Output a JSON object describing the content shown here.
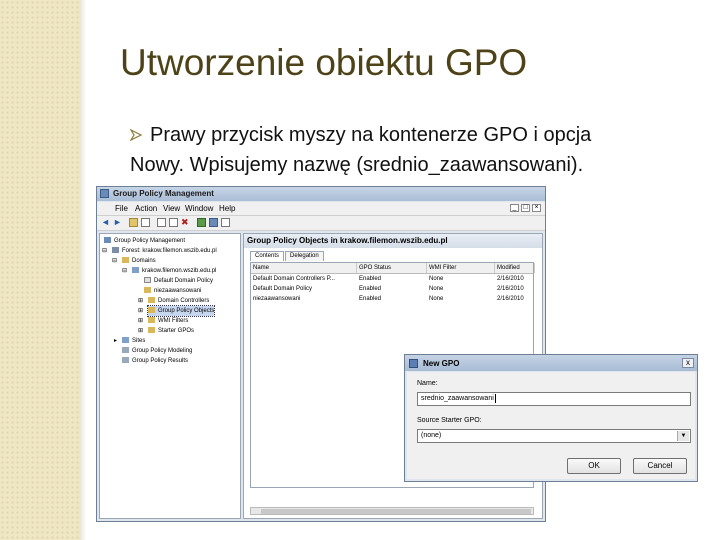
{
  "slide": {
    "title": "Utworzenie obiektu GPO",
    "bullet_line1": "Prawy przycisk myszy na kontenerze GPO i opcja",
    "bullet_line2": "Nowy. Wpisujemy nazwę (srednio_zaawansowani).",
    "colors": {
      "title": "#4e4218",
      "paper": "#efe6c4"
    }
  },
  "gpm": {
    "title": "Group Policy Management",
    "menu": [
      "File",
      "Action",
      "View",
      "Window",
      "Help"
    ],
    "tree": [
      {
        "label": "Group Policy Management",
        "indent": 0
      },
      {
        "label": "Forest: krakow.filemon.wszib.edu.pl",
        "indent": 1
      },
      {
        "label": "Domains",
        "indent": 2
      },
      {
        "label": "krakow.filemon.wszib.edu.pl",
        "indent": 3
      },
      {
        "label": "Default Domain Policy",
        "indent": 4
      },
      {
        "label": "niezaawansowani",
        "indent": 4
      },
      {
        "label": "Domain Controllers",
        "indent": 4
      },
      {
        "label": "Group Policy Objects",
        "indent": 4
      },
      {
        "label": "WMI Filters",
        "indent": 4
      },
      {
        "label": "Starter GPOs",
        "indent": 4
      },
      {
        "label": "Sites",
        "indent": 1
      },
      {
        "label": "Group Policy Modeling",
        "indent": 1
      },
      {
        "label": "Group Policy Results",
        "indent": 1
      }
    ],
    "right_header": "Group Policy Objects in krakow.filemon.wszib.edu.pl",
    "tabs": [
      "Contents",
      "Delegation"
    ],
    "columns": [
      "Name",
      "GPO Status",
      "WMI Filter",
      "Modified"
    ],
    "rows": [
      [
        "Default Domain Controllers P...",
        "Enabled",
        "None",
        "2/16/2010"
      ],
      [
        "Default Domain Policy",
        "Enabled",
        "None",
        "2/16/2010"
      ],
      [
        "niezaawansowani",
        "Enabled",
        "None",
        "2/16/2010"
      ]
    ]
  },
  "dialog": {
    "title": "New GPO",
    "close": "x",
    "name_label": "Name:",
    "name_value": "srednio_zaawansowani",
    "starter_label": "Source Starter GPO:",
    "starter_value": "(none)",
    "ok": "OK",
    "cancel": "Cancel"
  }
}
